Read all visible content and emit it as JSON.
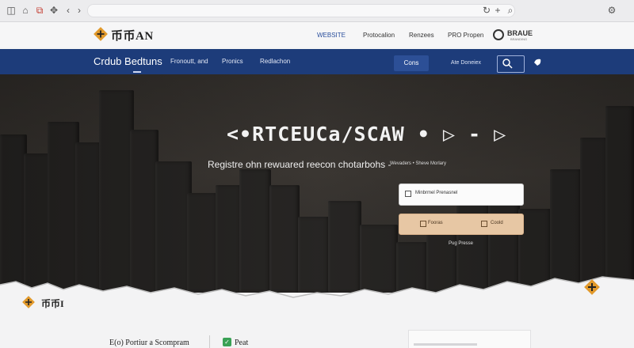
{
  "site": {
    "logo_text": "币币AN",
    "top_nav": [
      "WEBSITE",
      "Protocalion",
      "Renzees",
      "PRO Propen"
    ],
    "brand_text": "BRAUE",
    "brand_sub": "BRANDING"
  },
  "nav": {
    "title": "Crdub Bedtuns",
    "links": [
      "Fronoutt, and",
      "Pronics",
      "Redlachon"
    ],
    "button_1": "Cons",
    "button_2": "Ate Doneiex"
  },
  "hero": {
    "title": "<•RTCEUCa/SCAW • ▷ - ▷",
    "subtitle": "Registre ohn rewuared reecon chotarbohs -",
    "subtitle_small": "Wevaders • Sheve Morlary",
    "input_text": "Minbrmel Prenasnel",
    "button_left": "Fooras",
    "button_right": "Coold",
    "caption": "Pug Presse"
  },
  "lower": {
    "logo_text": "币币I",
    "text_1": "E(o) Portiur a Scompram",
    "text_2": "Peat"
  },
  "colors": {
    "nav_blue": "#1d3c7a",
    "accent_orange": "#e29a2c",
    "cta_peach": "#e7c7a4",
    "check_green": "#3aa155"
  }
}
